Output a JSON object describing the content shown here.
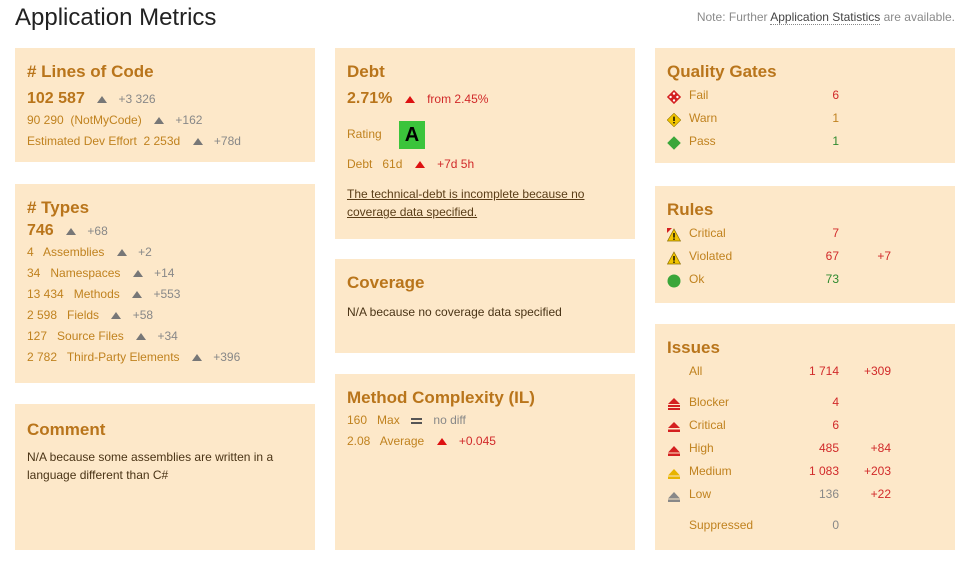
{
  "title": "Application Metrics",
  "note": {
    "prefix": "Note: Further ",
    "link": "Application Statistics",
    "suffix": " are available."
  },
  "loc": {
    "heading": "# Lines of Code",
    "value": "102 587",
    "diff": "+3 326",
    "notmycode_value": "90 290",
    "notmycode_label": "(NotMyCode)",
    "notmycode_diff": "+162",
    "effort_label": "Estimated Dev Effort",
    "effort_value": "2 253d",
    "effort_diff": "+78d"
  },
  "types": {
    "heading": "# Types",
    "value": "746",
    "diff": "+68",
    "rows": [
      {
        "value": "4",
        "label": "Assemblies",
        "diff": "+2"
      },
      {
        "value": "34",
        "label": "Namespaces",
        "diff": "+14"
      },
      {
        "value": "13 434",
        "label": "Methods",
        "diff": "+553"
      },
      {
        "value": "2 598",
        "label": "Fields",
        "diff": "+58"
      },
      {
        "value": "127",
        "label": "Source Files",
        "diff": "+34"
      },
      {
        "value": "2 782",
        "label": "Third-Party Elements",
        "diff": "+396"
      }
    ]
  },
  "comment": {
    "heading": "Comment",
    "text": "N/A because some assemblies are written in a language different than C#"
  },
  "debt": {
    "heading": "Debt",
    "percent": "2.71%",
    "from": "from 2.45%",
    "rating_label": "Rating",
    "rating": "A",
    "rating_color": "#3bc43b",
    "debt_label": "Debt",
    "debt_value": "61d",
    "debt_diff": "+7d 5h",
    "incomplete": "The technical-debt is incomplete because no coverage data specified."
  },
  "coverage": {
    "heading": "Coverage",
    "text": "N/A because no coverage data specified"
  },
  "complexity": {
    "heading": "Method Complexity (IL)",
    "max_value": "160",
    "max_label": "Max",
    "max_diff": "no diff",
    "avg_value": "2.08",
    "avg_label": "Average",
    "avg_diff": "+0.045"
  },
  "gates": {
    "heading": "Quality Gates",
    "rows": [
      {
        "icon": "fail-icon",
        "label": "Fail",
        "count": "6"
      },
      {
        "icon": "warn-icon",
        "label": "Warn",
        "count": "1"
      },
      {
        "icon": "pass-icon",
        "label": "Pass",
        "count": "1"
      }
    ]
  },
  "rules": {
    "heading": "Rules",
    "rows": [
      {
        "icon": "critical-rule-icon",
        "label": "Critical",
        "count": "7",
        "diff": ""
      },
      {
        "icon": "violated-rule-icon",
        "label": "Violated",
        "count": "67",
        "diff": "+7"
      },
      {
        "icon": "ok-rule-icon",
        "label": "Ok",
        "count": "73",
        "diff": ""
      }
    ]
  },
  "issues": {
    "heading": "Issues",
    "all_label": "All",
    "all_count": "1 714",
    "all_diff": "+309",
    "rows": [
      {
        "icon": "blocker-icon",
        "label": "Blocker",
        "count": "4",
        "diff": ""
      },
      {
        "icon": "critical-issue-icon",
        "label": "Critical",
        "count": "6",
        "diff": ""
      },
      {
        "icon": "high-issue-icon",
        "label": "High",
        "count": "485",
        "diff": "+84"
      },
      {
        "icon": "medium-issue-icon",
        "label": "Medium",
        "count": "1 083",
        "diff": "+203"
      },
      {
        "icon": "low-issue-icon",
        "label": "Low",
        "count": "136",
        "diff": "+22"
      }
    ],
    "suppressed_label": "Suppressed",
    "suppressed_count": "0"
  },
  "colors": {
    "card_bg": "#fde8c9",
    "heading": "#b9751b",
    "increase": "#d12a2a",
    "ok": "#2e8a2e"
  }
}
